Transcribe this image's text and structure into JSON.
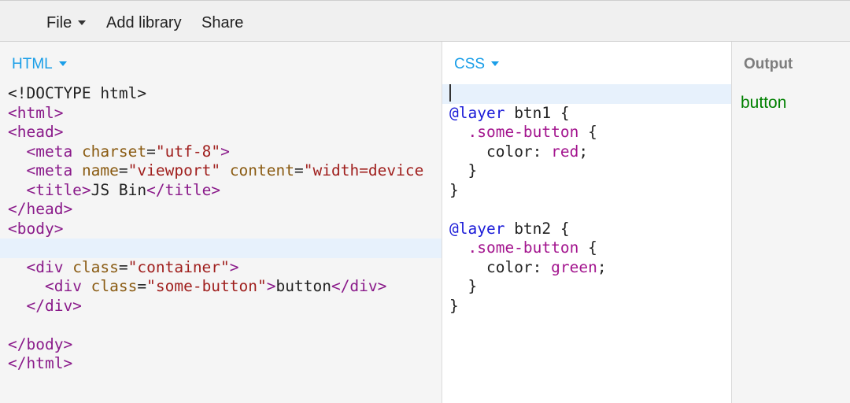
{
  "toolbar": {
    "file_label": "File",
    "add_library_label": "Add library",
    "share_label": "Share"
  },
  "panels": {
    "html": {
      "label": "HTML",
      "lines": [
        [
          [
            "txt",
            "<!DOCTYPE html>"
          ]
        ],
        [
          [
            "tag",
            "<html>"
          ]
        ],
        [
          [
            "tag",
            "<head>"
          ]
        ],
        [
          [
            "txt",
            "  "
          ],
          [
            "tag",
            "<meta "
          ],
          [
            "attr",
            "charset"
          ],
          [
            "txt",
            "="
          ],
          [
            "str",
            "\"utf-8\""
          ],
          [
            "tag",
            ">"
          ]
        ],
        [
          [
            "txt",
            "  "
          ],
          [
            "tag",
            "<meta "
          ],
          [
            "attr",
            "name"
          ],
          [
            "txt",
            "="
          ],
          [
            "str",
            "\"viewport\""
          ],
          [
            "txt",
            " "
          ],
          [
            "attr",
            "content"
          ],
          [
            "txt",
            "="
          ],
          [
            "str",
            "\"width=device"
          ]
        ],
        [
          [
            "txt",
            "  "
          ],
          [
            "tag",
            "<title>"
          ],
          [
            "txt",
            "JS Bin"
          ],
          [
            "tag",
            "</title>"
          ]
        ],
        [
          [
            "tag",
            "</head>"
          ]
        ],
        [
          [
            "tag",
            "<body>"
          ]
        ],
        [],
        [
          [
            "txt",
            "  "
          ],
          [
            "tag",
            "<div "
          ],
          [
            "attr",
            "class"
          ],
          [
            "txt",
            "="
          ],
          [
            "str",
            "\"container\""
          ],
          [
            "tag",
            ">"
          ]
        ],
        [
          [
            "txt",
            "    "
          ],
          [
            "tag",
            "<div "
          ],
          [
            "attr",
            "class"
          ],
          [
            "txt",
            "="
          ],
          [
            "str",
            "\"some-button\""
          ],
          [
            "tag",
            ">"
          ],
          [
            "txt",
            "button"
          ],
          [
            "tag",
            "</div>"
          ]
        ],
        [
          [
            "txt",
            "  "
          ],
          [
            "tag",
            "</div>"
          ]
        ],
        [],
        [
          [
            "tag",
            "</body>"
          ]
        ],
        [
          [
            "tag",
            "</html>"
          ]
        ]
      ],
      "active_line": 8
    },
    "css": {
      "label": "CSS",
      "lines": [
        [],
        [
          [
            "at",
            "@layer"
          ],
          [
            "txt",
            " btn1 {"
          ]
        ],
        [
          [
            "txt",
            "  "
          ],
          [
            "sel",
            ".some-button"
          ],
          [
            "txt",
            " {"
          ]
        ],
        [
          [
            "txt",
            "    "
          ],
          [
            "prop",
            "color"
          ],
          [
            "txt",
            ": "
          ],
          [
            "kw",
            "red"
          ],
          [
            "txt",
            ";"
          ]
        ],
        [
          [
            "txt",
            "  }"
          ]
        ],
        [
          [
            "txt",
            "}"
          ]
        ],
        [],
        [
          [
            "at",
            "@layer"
          ],
          [
            "txt",
            " btn2 {"
          ]
        ],
        [
          [
            "txt",
            "  "
          ],
          [
            "sel",
            ".some-button"
          ],
          [
            "txt",
            " {"
          ]
        ],
        [
          [
            "txt",
            "    "
          ],
          [
            "prop",
            "color"
          ],
          [
            "txt",
            ": "
          ],
          [
            "kw",
            "green"
          ],
          [
            "txt",
            ";"
          ]
        ],
        [
          [
            "txt",
            "  }"
          ]
        ],
        [
          [
            "txt",
            "}"
          ]
        ]
      ],
      "active_line": 0
    },
    "output": {
      "label": "Output",
      "text": "button",
      "text_color": "#008000"
    }
  },
  "colors": {
    "accent": "#1a9ee8",
    "active_line": "#e7f1fc"
  },
  "icons": {
    "dropdown": "caret-down-icon"
  }
}
